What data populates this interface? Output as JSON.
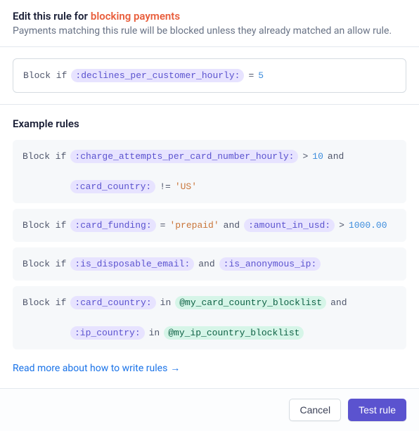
{
  "header": {
    "title_prefix": "Edit this rule for",
    "title_highlight": "blocking payments",
    "subtitle": "Payments matching this rule will be blocked unless they already matched an allow rule."
  },
  "editor": {
    "keyword": "Block if",
    "attribute": ":declines_per_customer_hourly:",
    "operator": "=",
    "value": "5"
  },
  "examples_title": "Example rules",
  "examples": [
    {
      "tokens": [
        {
          "t": "kw",
          "v": "Block if"
        },
        {
          "t": "attr",
          "v": ":charge_attempts_per_card_number_hourly:"
        },
        {
          "t": "op",
          "v": ">"
        },
        {
          "t": "num",
          "v": "10"
        },
        {
          "t": "op",
          "v": "and"
        },
        {
          "t": "break"
        },
        {
          "t": "indent"
        },
        {
          "t": "attr",
          "v": ":card_country:"
        },
        {
          "t": "op",
          "v": "!="
        },
        {
          "t": "str",
          "v": "'US'"
        }
      ]
    },
    {
      "tokens": [
        {
          "t": "kw",
          "v": "Block if"
        },
        {
          "t": "attr",
          "v": ":card_funding:"
        },
        {
          "t": "op",
          "v": "="
        },
        {
          "t": "str",
          "v": "'prepaid'"
        },
        {
          "t": "op",
          "v": "and"
        },
        {
          "t": "attr",
          "v": ":amount_in_usd:"
        },
        {
          "t": "op",
          "v": ">"
        },
        {
          "t": "num",
          "v": "1000.00"
        }
      ]
    },
    {
      "tokens": [
        {
          "t": "kw",
          "v": "Block if"
        },
        {
          "t": "attr",
          "v": ":is_disposable_email:"
        },
        {
          "t": "op",
          "v": "and"
        },
        {
          "t": "attr",
          "v": ":is_anonymous_ip:"
        }
      ]
    },
    {
      "tokens": [
        {
          "t": "kw",
          "v": "Block if"
        },
        {
          "t": "attr",
          "v": ":card_country:"
        },
        {
          "t": "op",
          "v": "in"
        },
        {
          "t": "list",
          "v": "@my_card_country_blocklist"
        },
        {
          "t": "op",
          "v": "and"
        },
        {
          "t": "break"
        },
        {
          "t": "indent"
        },
        {
          "t": "attr",
          "v": ":ip_country:"
        },
        {
          "t": "op",
          "v": "in"
        },
        {
          "t": "list",
          "v": "@my_ip_country_blocklist"
        }
      ]
    }
  ],
  "link": {
    "label": "Read more about how to write rules",
    "arrow": "→"
  },
  "footer": {
    "cancel": "Cancel",
    "test": "Test rule"
  }
}
